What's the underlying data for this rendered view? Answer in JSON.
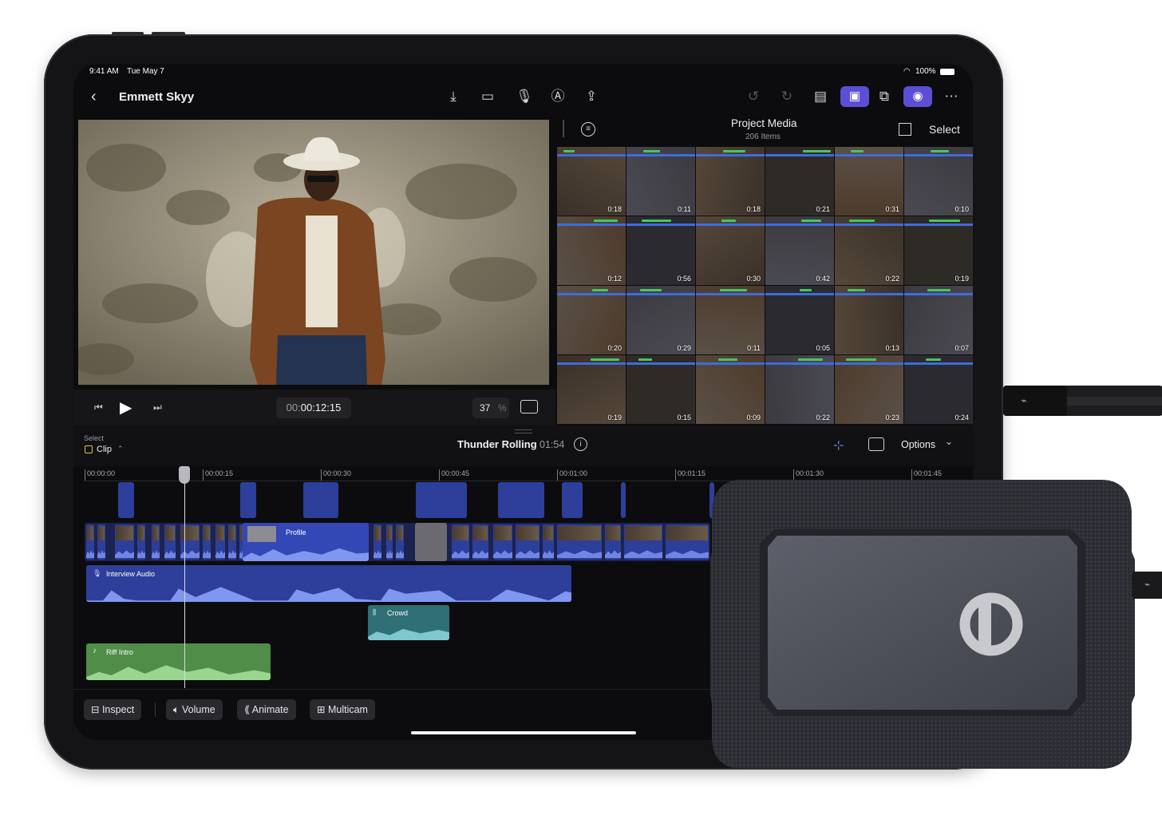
{
  "status_bar": {
    "time": "9:41 AM",
    "date": "Tue May 7",
    "battery": "100%"
  },
  "toolbar": {
    "back_icon": "chevron-left-icon",
    "project_title": "Emmett Skyy"
  },
  "browser": {
    "title": "Project Media",
    "count": "206 Items",
    "select_label": "Select",
    "durations": [
      "0:18",
      "0:11",
      "0:18",
      "0:21",
      "0:31",
      "0:10",
      "0:12",
      "0:56",
      "0:30",
      "0:42",
      "0:22",
      "0:19",
      "0:20",
      "0:29",
      "0:11",
      "0:05",
      "0:13",
      "0:07",
      "0:19",
      "0:15",
      "0:09",
      "0:22",
      "0:23",
      "0:24"
    ]
  },
  "playback": {
    "timecode_dim": "00:",
    "timecode_main": "00:12:15",
    "zoom_value": "37",
    "zoom_unit": "%"
  },
  "timeline_header": {
    "select_label": "Select",
    "mode": "Clip",
    "project_name": "Thunder Rolling",
    "duration": "01:54",
    "options_label": "Options"
  },
  "ruler": [
    "00:00:00",
    "00:00:15",
    "00:00:30",
    "00:00:45",
    "00:01:00",
    "00:01:15",
    "00:01:30",
    "00:01:45"
  ],
  "clips": {
    "profile": "Profile",
    "interview": "Interview Audio",
    "crowd": "Crowd",
    "riff": "Riff Intro"
  },
  "bottom_bar": {
    "inspect": "Inspect",
    "volume": "Volume",
    "animate": "Animate",
    "multicam": "Multicam"
  },
  "colors": {
    "accent": "#5b4fd6",
    "clip_blue": "#2d3f9a",
    "audio_teal": "#2f6f76",
    "audio_green": "#4f8d48",
    "ssd_body": "#4a4c54"
  }
}
